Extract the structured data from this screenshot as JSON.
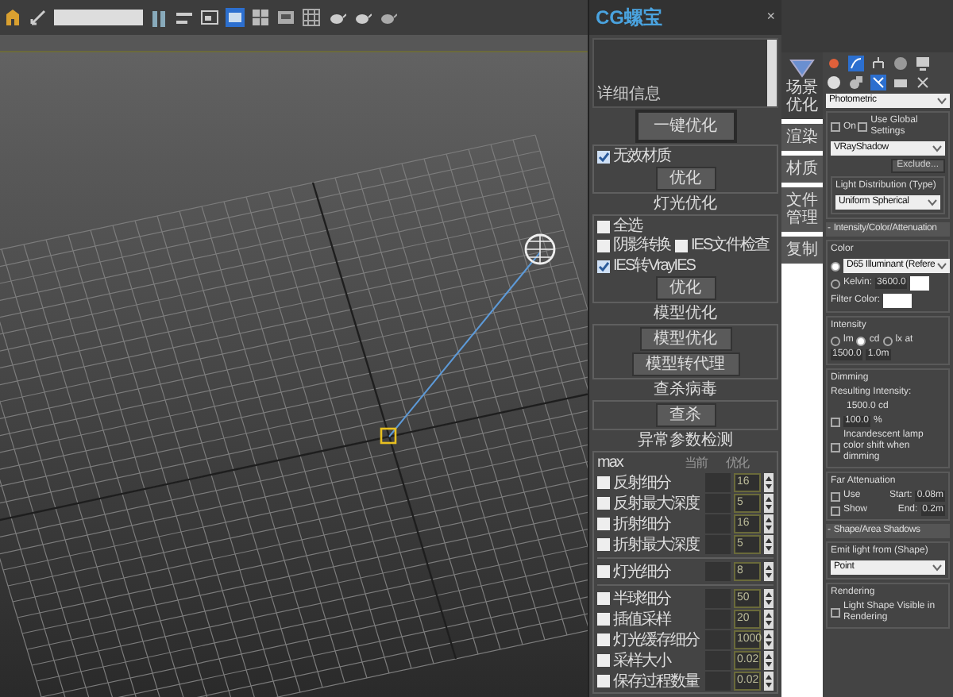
{
  "plugin": {
    "title": "CG螺宝",
    "close": "×",
    "info_label": "详细信息",
    "one_click_button": "一键优化",
    "material": {
      "options": [
        {
          "label": "无效材质",
          "checked": true
        }
      ],
      "button": "优化"
    },
    "light": {
      "title": "灯光优化",
      "select_all": {
        "label": "全选",
        "checked": false
      },
      "options": [
        {
          "label": "阴影转换",
          "checked": false
        },
        {
          "label": "IES文件检查",
          "checked": false
        },
        {
          "label": "IES转VrayIES",
          "checked": true
        }
      ],
      "button": "优化"
    },
    "model": {
      "title": "模型优化",
      "buttons": [
        "模型优化",
        "模型转代理"
      ]
    },
    "virus": {
      "title": "查杀病毒",
      "button": "查杀"
    },
    "params": {
      "title": "异常参数检测",
      "columns": [
        "max",
        "当前",
        "优化"
      ],
      "groups": [
        [
          {
            "label": "反射细分",
            "checked": false,
            "value": "16"
          },
          {
            "label": "反射最大深度",
            "checked": false,
            "value": "5"
          },
          {
            "label": "折射细分",
            "checked": false,
            "value": "16"
          },
          {
            "label": "折射最大深度",
            "checked": false,
            "value": "5"
          }
        ],
        [
          {
            "label": "灯光细分",
            "checked": false,
            "value": "8"
          }
        ],
        [
          {
            "label": "半球细分",
            "checked": false,
            "value": "50"
          },
          {
            "label": "插值采样",
            "checked": false,
            "value": "20"
          },
          {
            "label": "灯光缓存细分",
            "checked": false,
            "value": "1000"
          },
          {
            "label": "采样大小",
            "checked": false,
            "value": "0.02"
          },
          {
            "label": "保存过程数量",
            "checked": false,
            "value": "0.02"
          }
        ]
      ]
    }
  },
  "side_tabs": [
    {
      "label": "场景优化",
      "selected": true
    },
    {
      "label": "渲染",
      "selected": false
    },
    {
      "label": "材质",
      "selected": false
    },
    {
      "label": "文件管理",
      "selected": false
    },
    {
      "label": "复制",
      "selected": false
    }
  ],
  "command_panel": {
    "light_type": "Photometric",
    "shadows": {
      "options": [
        {
          "label": "On",
          "checked": false
        },
        {
          "label": "Use Global Settings",
          "checked": false
        }
      ],
      "type": "VRayShadow",
      "exclude_button": "Exclude..."
    },
    "distribution": {
      "title": "Light Distribution (Type)",
      "value": "Uniform Spherical"
    },
    "rollout_1": {
      "toggle": "-",
      "title": "Intensity/Color/Attenuation"
    },
    "color": {
      "title": "Color",
      "radios": [
        {
          "selected": true,
          "value": "D65 Illuminant (Refere"
        },
        {
          "selected": false,
          "label": "Kelvin:",
          "value": "3600.0"
        }
      ],
      "filter_label": "Filter Color:"
    },
    "intensity": {
      "title": "Intensity",
      "units": [
        {
          "label": "lm",
          "selected": false
        },
        {
          "label": "cd",
          "selected": true
        },
        {
          "label": "lx at",
          "selected": false
        }
      ],
      "value": "1500.0",
      "distance": "1.0m"
    },
    "dimming": {
      "title": "Dimming",
      "resulting_label": "Resulting Intensity:",
      "resulting_value": "1500.0 cd",
      "percent_checked": false,
      "percent_value": "100.0",
      "percent_unit": "%",
      "incandescent": {
        "label": "Incandescent lamp color shift when dimming",
        "checked": false
      }
    },
    "far_attenuation": {
      "title": "Far Attenuation",
      "rows": [
        {
          "label": "Use",
          "checked": false,
          "field_label": "Start:",
          "value": "0.08m"
        },
        {
          "label": "Show",
          "checked": false,
          "field_label": "End:",
          "value": "0.2m"
        }
      ]
    },
    "rollout_2": {
      "toggle": "-",
      "title": "Shape/Area Shadows"
    },
    "emit": {
      "title": "Emit light from (Shape)",
      "value": "Point"
    },
    "rendering": {
      "title": "Rendering",
      "option": {
        "label": "Light Shape Visible in Rendering",
        "checked": false
      }
    }
  }
}
